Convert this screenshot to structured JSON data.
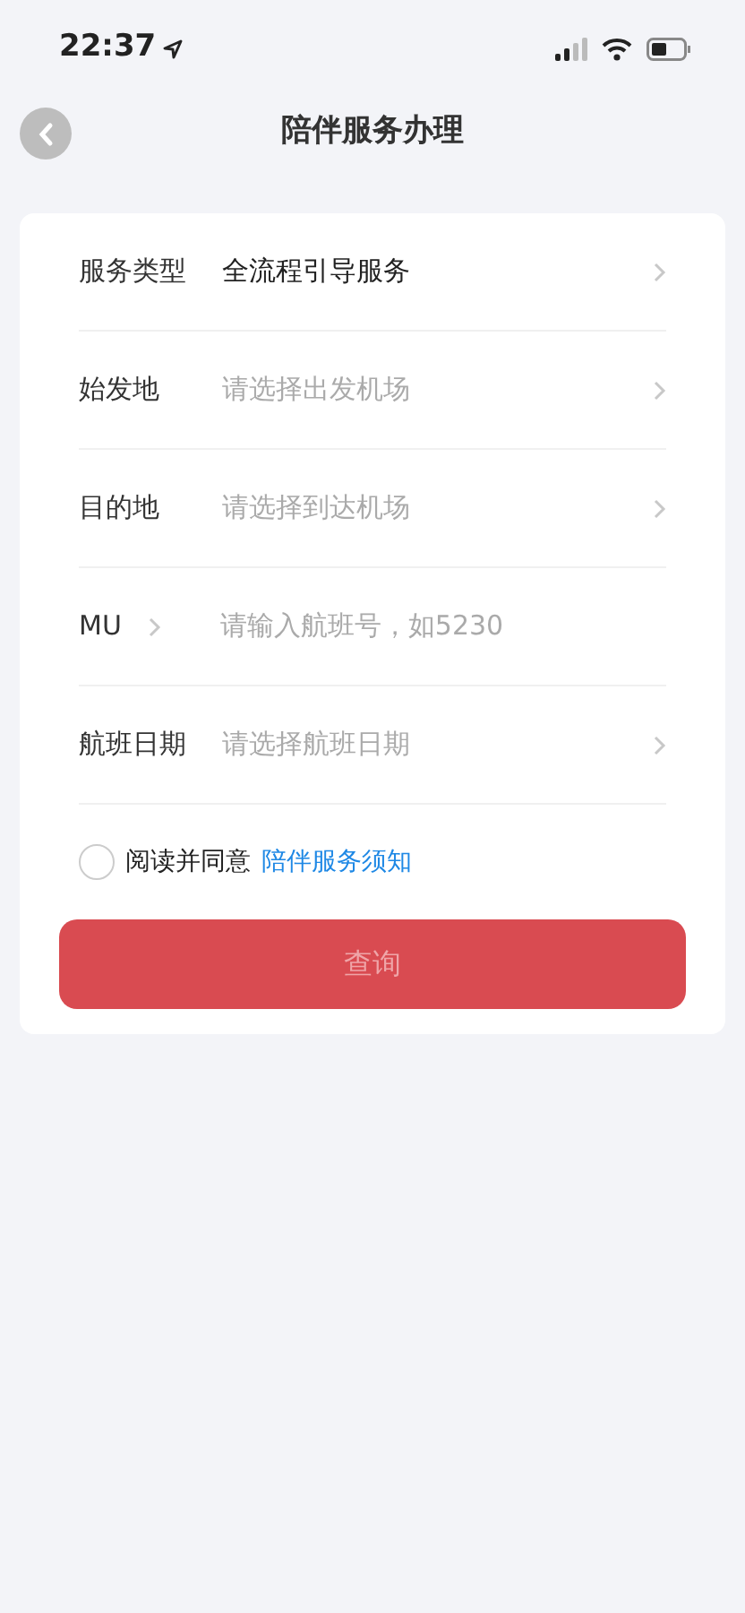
{
  "status_bar": {
    "time": "22:37"
  },
  "header": {
    "title": "陪伴服务办理"
  },
  "form": {
    "rows": [
      {
        "kind": "select",
        "label": "服务类型",
        "value": "全流程引导服务"
      },
      {
        "kind": "select",
        "label": "始发地",
        "placeholder": "请选择出发机场"
      },
      {
        "kind": "select",
        "label": "目的地",
        "placeholder": "请选择到达机场"
      },
      {
        "kind": "input",
        "label": "MU",
        "placeholder": "请输入航班号，如5230"
      },
      {
        "kind": "select",
        "label": "航班日期",
        "placeholder": "请选择航班日期"
      }
    ],
    "agreement": {
      "checked": false,
      "text": "阅读并同意",
      "link": "陪伴服务须知"
    },
    "submit": {
      "label": "查询",
      "disabled": true
    }
  }
}
